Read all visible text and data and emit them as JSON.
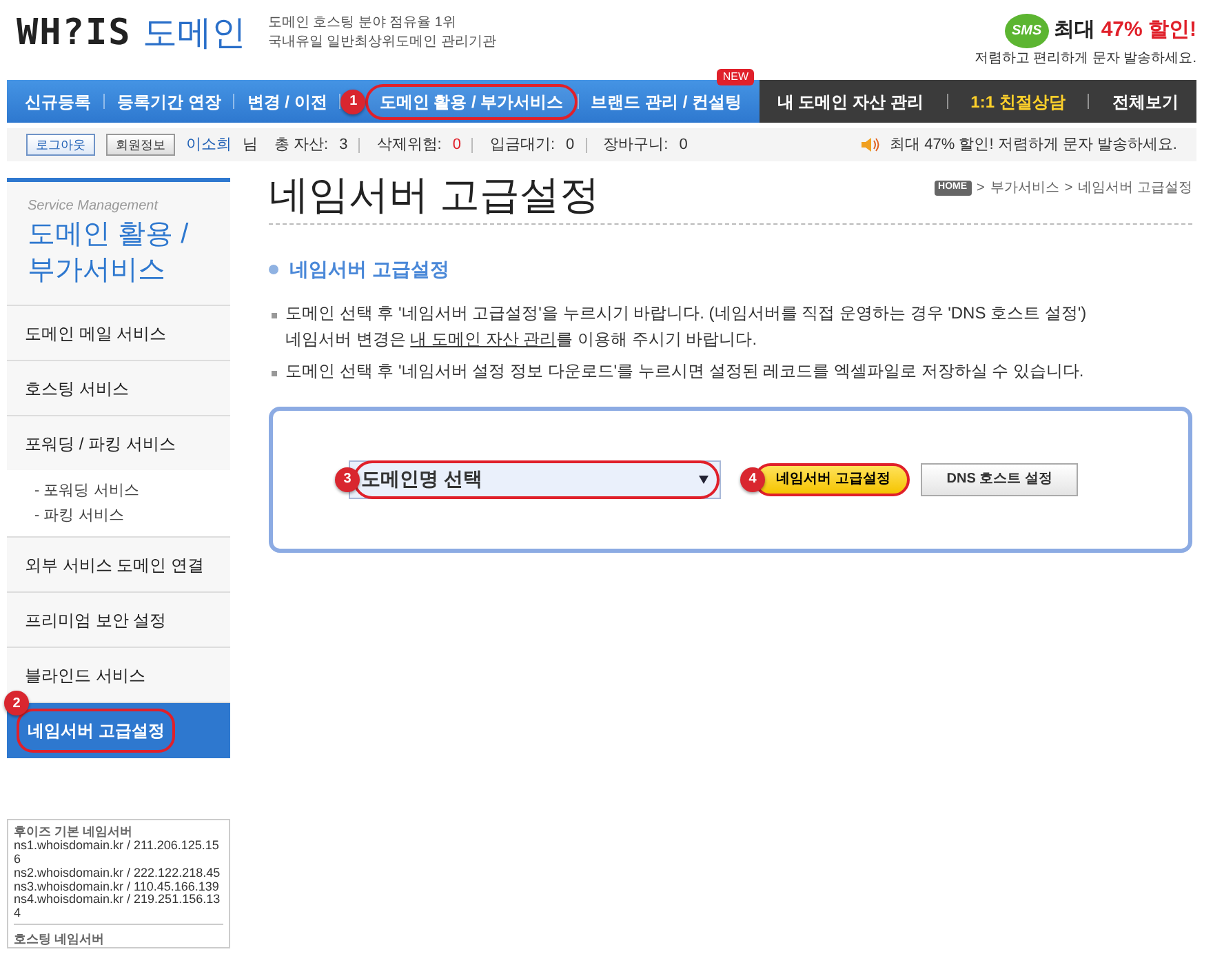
{
  "header": {
    "logo": "WH?IS",
    "logo_suffix": "도메인",
    "tagline": [
      "도메인 호스팅 분야 점유율 1위",
      "국내유일 일반최상위도메인 관리기관"
    ],
    "promo": {
      "badge": "SMS",
      "title": "최대 **47% 할인!**",
      "subtitle": "저렴하고 편리하게 문자 발송하세요."
    }
  },
  "nav": [
    {
      "label": "신규등록",
      "selected": false,
      "kind": "main"
    },
    {
      "label": "등록기간 연장",
      "selected": false,
      "kind": "main"
    },
    {
      "label": "변경 / 이전",
      "selected": false,
      "kind": "main"
    },
    {
      "label": "도메인 활용 / 부가서비스",
      "selected": true,
      "kind": "main",
      "callout": "1"
    },
    {
      "label": "브랜드 관리 / 컨설팅",
      "selected": false,
      "kind": "main",
      "badge": "NEW"
    },
    {
      "label": "내 도메인 자산 관리",
      "selected": false,
      "kind": "dark"
    },
    {
      "label": "1:1 친절상담",
      "selected": false,
      "kind": "highlight"
    },
    {
      "label": "전체보기",
      "selected": false,
      "kind": "dark"
    }
  ],
  "user_bar": {
    "buttons": [
      "로그아웃",
      "회원정보"
    ],
    "user": "이소희",
    "suffix": "님",
    "stats": [
      {
        "label": "총 자산:",
        "value": "3",
        "alert": false
      },
      {
        "label": "삭제위험:",
        "value": "0",
        "alert": true
      },
      {
        "label": "입금대기:",
        "value": "0",
        "alert": false
      },
      {
        "label": "장바구니:",
        "value": "0",
        "alert": false
      }
    ],
    "notice": "최대 47% 할인! 저렴하게 문자 발송하세요."
  },
  "sidebar": {
    "subtitle": "Service Management",
    "title": "도메인 활용 / 부가서비스",
    "items": [
      {
        "label": "도메인 메일 서비스",
        "selected": false
      },
      {
        "label": "호스팅 서비스",
        "selected": false
      },
      {
        "label": "포워딩 / 파킹 서비스",
        "selected": false,
        "children": [
          {
            "label": "- 포워딩 서비스"
          },
          {
            "label": "- 파킹 서비스"
          }
        ]
      },
      {
        "label": "외부 서비스 도메인 연결",
        "selected": false
      },
      {
        "label": "프리미엄 보안 설정",
        "selected": false
      },
      {
        "label": "블라인드 서비스",
        "selected": false
      },
      {
        "label": "네임서버 고급설정",
        "selected": true,
        "callout": "2"
      }
    ],
    "nameservers": [
      {
        "heading": "후이즈 기본 네임서버",
        "lines": [
          "ns1.whoisdomain.kr / 211.206.125.156",
          "ns2.whoisdomain.kr / 222.122.218.45",
          "ns3.whoisdomain.kr / 110.45.166.139",
          "ns4.whoisdomain.kr / 219.251.156.134"
        ]
      },
      {
        "heading": "호스팅 네임서버"
      }
    ]
  },
  "page": {
    "title": "네임서버 고급설정",
    "breadcrumb": [
      "HOME",
      "부가서비스",
      "네임서버 고급설정"
    ],
    "breadcrumb_sep": ">",
    "section": "네임서버 고급설정",
    "bullets": [
      "도메인 선택 후 '네임서버 고급설정'을 누르시기 바랍니다. (네임서버를 직접 운영하는 경우 'DNS 호스트 설정')",
      "도메인 선택 후 '네임서버 설정 정보 다운로드'를 누르시면 설정된 레코드를 엑셀파일로 저장하실 수 있습니다."
    ],
    "bullet_note": {
      "before": "네임서버 변경은 ",
      "link": "내 도메인 자산 관리",
      "after": "를 이용해 주시기 바랍니다."
    },
    "form": {
      "select": {
        "value": "도메인명 선택",
        "callout": "3"
      },
      "buttons": [
        {
          "label": "네임서버 고급설정",
          "kind": "primary",
          "callout": "4"
        },
        {
          "label": "DNS 호스트 설정",
          "kind": "secondary"
        }
      ]
    }
  }
}
